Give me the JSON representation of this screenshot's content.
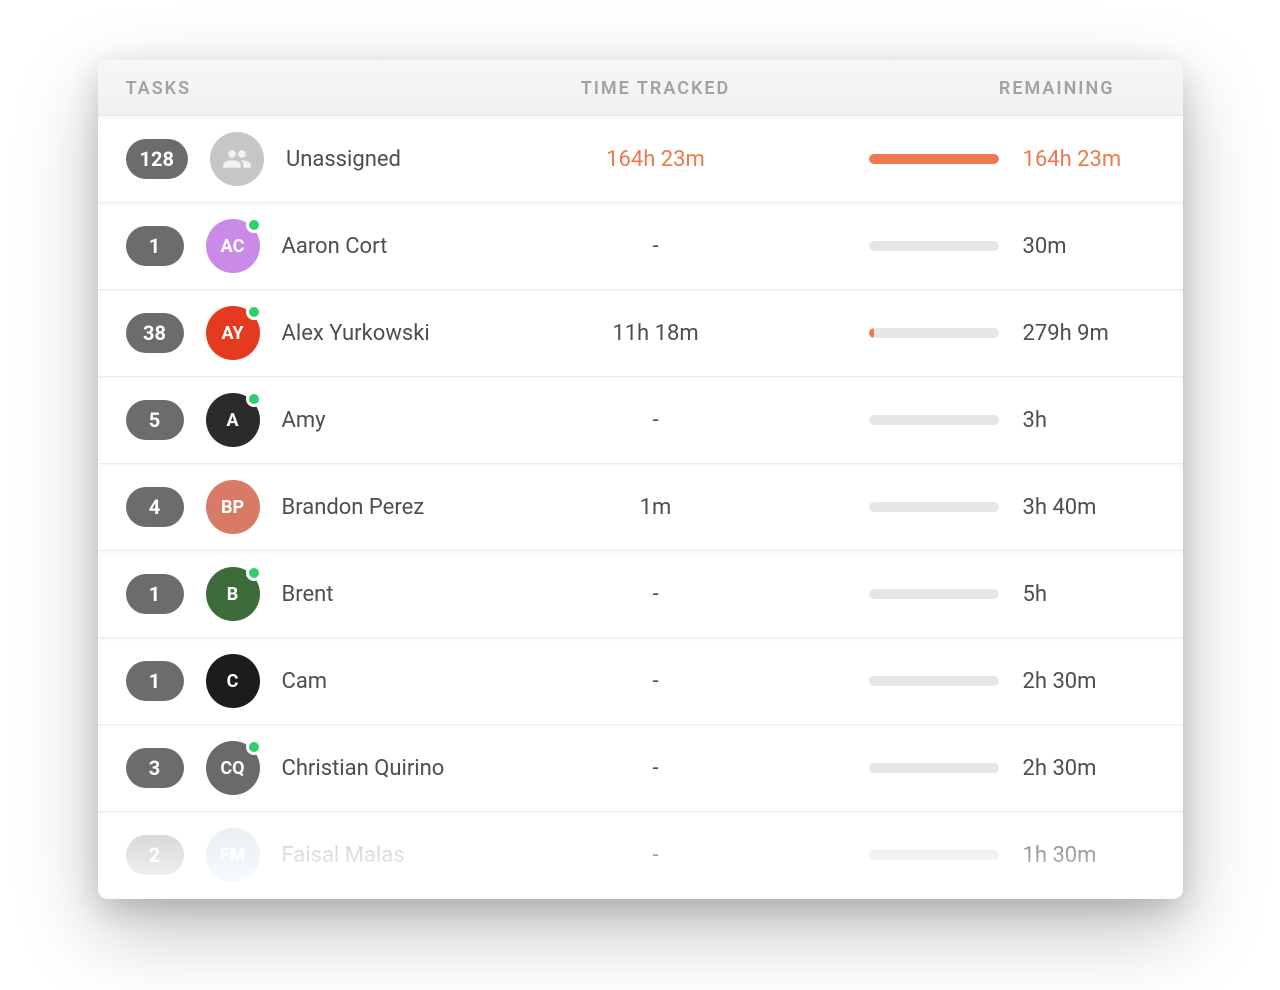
{
  "columns": {
    "tasks": "TASKS",
    "time_tracked": "TIME TRACKED",
    "remaining": "REMAINING"
  },
  "rows": [
    {
      "task_count": "128",
      "name": "Unassigned",
      "time_tracked": "164h 23m",
      "remaining": "164h 23m",
      "progress_pct": 100,
      "accent": true,
      "avatar_type": "group",
      "avatar_bg": "#c6c6c6",
      "online": false
    },
    {
      "task_count": "1",
      "name": "Aaron Cort",
      "time_tracked": "-",
      "remaining": "30m",
      "progress_pct": 0,
      "accent": false,
      "avatar_type": "initials",
      "initials": "AC",
      "avatar_bg": "#c98ae8",
      "online": true
    },
    {
      "task_count": "38",
      "name": "Alex Yurkowski",
      "time_tracked": "11h 18m",
      "remaining": "279h 9m",
      "progress_pct": 4,
      "accent": false,
      "avatar_type": "initials",
      "initials": "AY",
      "avatar_bg": "#e43a1f",
      "online": true
    },
    {
      "task_count": "5",
      "name": "Amy",
      "time_tracked": "-",
      "remaining": "3h",
      "progress_pct": 0,
      "accent": false,
      "avatar_type": "initials",
      "initials": "A",
      "avatar_bg": "#2b2b2b",
      "online": true
    },
    {
      "task_count": "4",
      "name": "Brandon Perez",
      "time_tracked": "1m",
      "remaining": "3h 40m",
      "progress_pct": 0,
      "accent": false,
      "avatar_type": "initials",
      "initials": "BP",
      "avatar_bg": "#d77a66",
      "online": false
    },
    {
      "task_count": "1",
      "name": "Brent",
      "time_tracked": "-",
      "remaining": "5h",
      "progress_pct": 0,
      "accent": false,
      "avatar_type": "initials",
      "initials": "B",
      "avatar_bg": "#3d6b3a",
      "online": true
    },
    {
      "task_count": "1",
      "name": "Cam",
      "time_tracked": "-",
      "remaining": "2h 30m",
      "progress_pct": 0,
      "accent": false,
      "avatar_type": "initials",
      "initials": "C",
      "avatar_bg": "#1c1c1c",
      "online": false
    },
    {
      "task_count": "3",
      "name": "Christian Quirino",
      "time_tracked": "-",
      "remaining": "2h 30m",
      "progress_pct": 0,
      "accent": false,
      "avatar_type": "initials",
      "initials": "CQ",
      "avatar_bg": "#6a6a6a",
      "online": true
    },
    {
      "task_count": "2",
      "name": "Faisal Malas",
      "time_tracked": "-",
      "remaining": "1h 30m",
      "progress_pct": 0,
      "accent": false,
      "avatar_type": "initials",
      "initials": "FM",
      "avatar_bg": "#b0c8d8",
      "online": false,
      "faded": true
    }
  ]
}
